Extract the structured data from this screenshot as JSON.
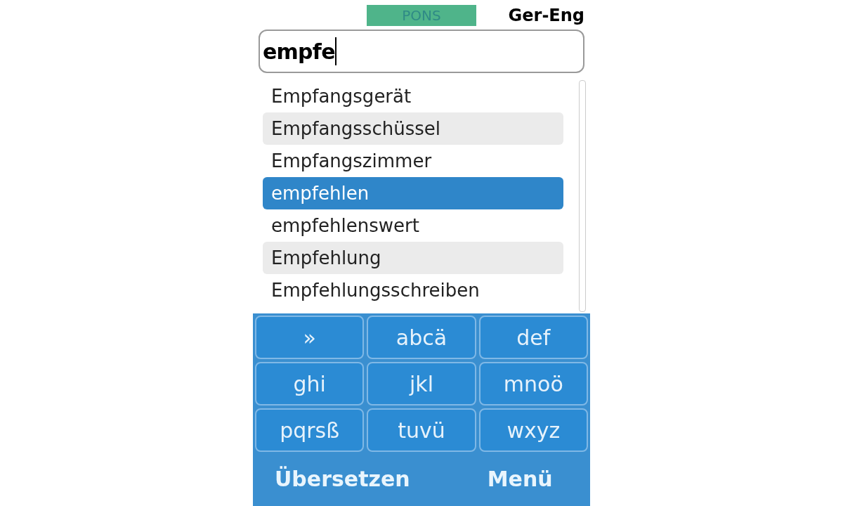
{
  "header": {
    "brand": "PONS",
    "direction": "Ger-Eng"
  },
  "search": {
    "value": "empfe"
  },
  "results": [
    {
      "word": "Empfangsgerät",
      "selected": false
    },
    {
      "word": "Empfangsschüssel",
      "selected": false
    },
    {
      "word": "Empfangszimmer",
      "selected": false
    },
    {
      "word": "empfehlen",
      "selected": true
    },
    {
      "word": "empfehlenswert",
      "selected": false
    },
    {
      "word": "Empfehlung",
      "selected": false
    },
    {
      "word": "Empfehlungsschreiben",
      "selected": false
    }
  ],
  "keypad": [
    "»",
    "abcä",
    "def",
    "ghi",
    "jkl",
    "mnoö",
    "pqrsß",
    "tuvü",
    "wxyz"
  ],
  "softkeys": {
    "left": "Übersetzen",
    "right": "Menü"
  }
}
